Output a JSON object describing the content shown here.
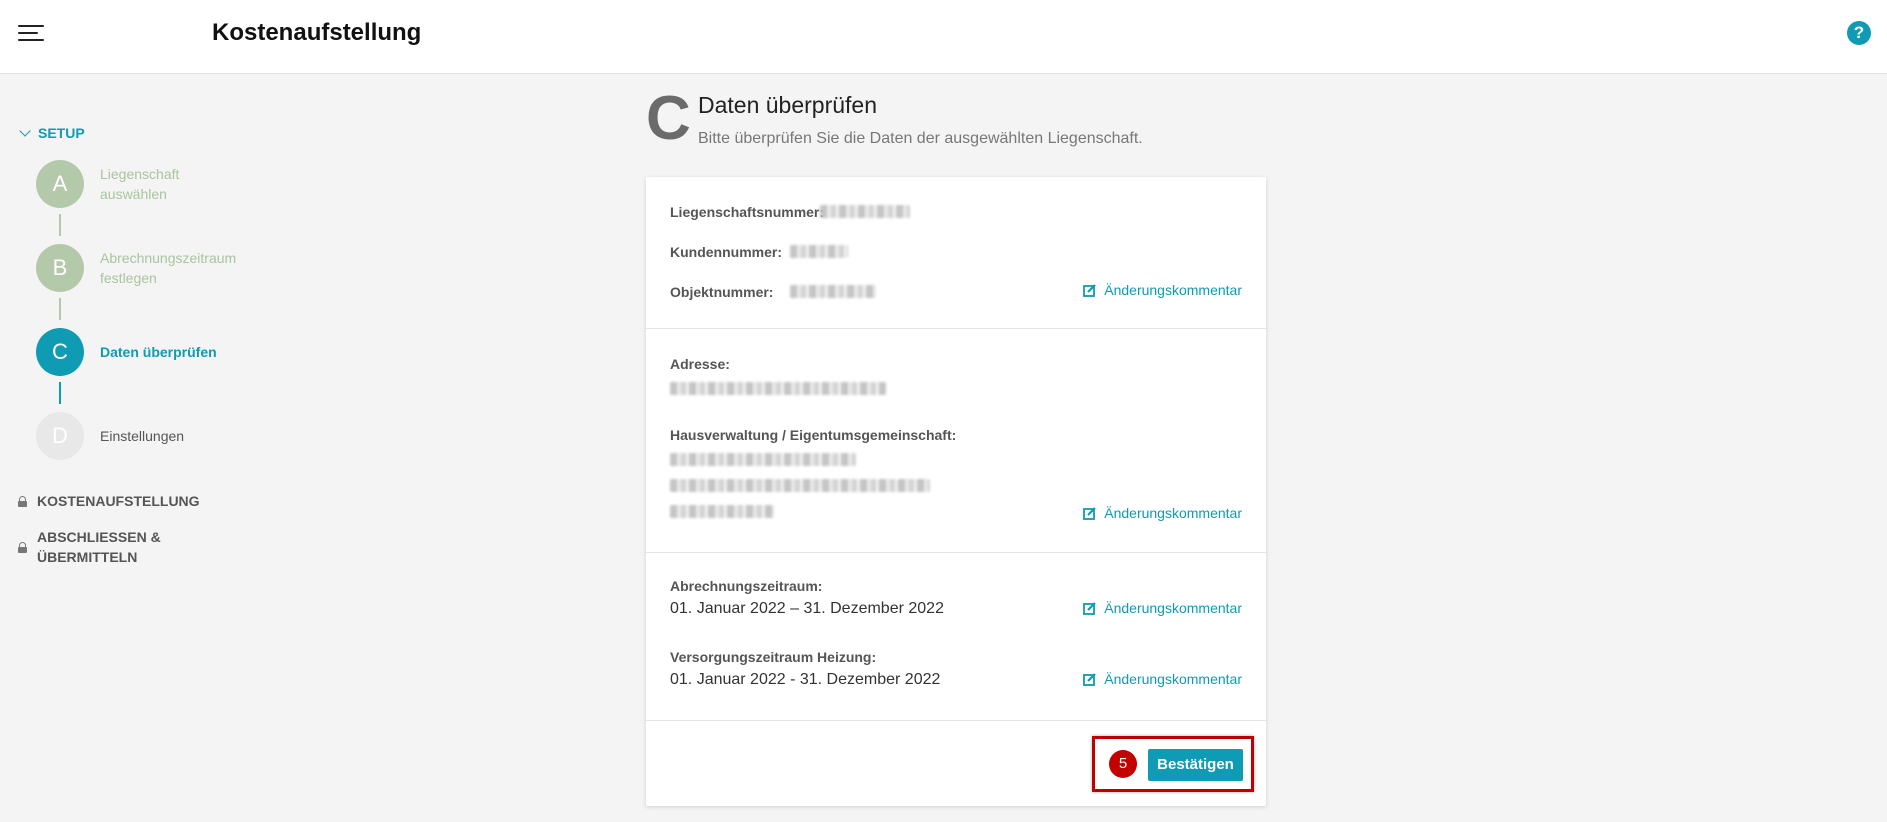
{
  "header": {
    "title": "Kostenaufstellung",
    "menu_icon": "hamburger-menu-icon",
    "help_icon": "?"
  },
  "sidebar": {
    "section_title": "SETUP",
    "steps": [
      {
        "letter": "A",
        "label_line1": "Liegenschaft",
        "label_line2": "auswählen",
        "state": "done"
      },
      {
        "letter": "B",
        "label_line1": "Abrechnungszeitraum",
        "label_line2": "festlegen",
        "state": "done"
      },
      {
        "letter": "C",
        "label_line1": "Daten überprüfen",
        "state": "active"
      },
      {
        "letter": "D",
        "label_line1": "Einstellungen",
        "state": "todo"
      }
    ],
    "locked_sections": [
      {
        "label_line1": "KOSTENAUFSTELLUNG"
      },
      {
        "label_line1": "ABSCHLIESSEN &",
        "label_line2": "ÜBERMITTELN"
      }
    ]
  },
  "main": {
    "step_letter": "C",
    "title": "Daten überprüfen",
    "subtitle": "Bitte überprüfen Sie die Daten der ausgewählten Liegenschaft.",
    "sections": {
      "ids": {
        "property_number_label": "Liegenschaftsnummer:",
        "customer_number_label": "Kundennummer:",
        "object_number_label": "Objektnummer:"
      },
      "address": {
        "address_label": "Adresse:",
        "management_label": "Hausverwaltung / Eigentumsgemeinschaft:"
      },
      "periods": {
        "billing_label": "Abrechnungszeitraum:",
        "billing_value": "01. Januar 2022 – 31. Dezember 2022",
        "heating_label": "Versorgungszeitraum Heizung:",
        "heating_value": "01. Januar 2022 - 31. Dezember 2022"
      }
    },
    "change_comment_label": "Änderungskommentar",
    "annotation_number": "5",
    "confirm_button": "Bestätigen"
  },
  "colors": {
    "accent": "#0e9bb3",
    "done": "#b3c9a9",
    "highlight": "#c00000"
  }
}
